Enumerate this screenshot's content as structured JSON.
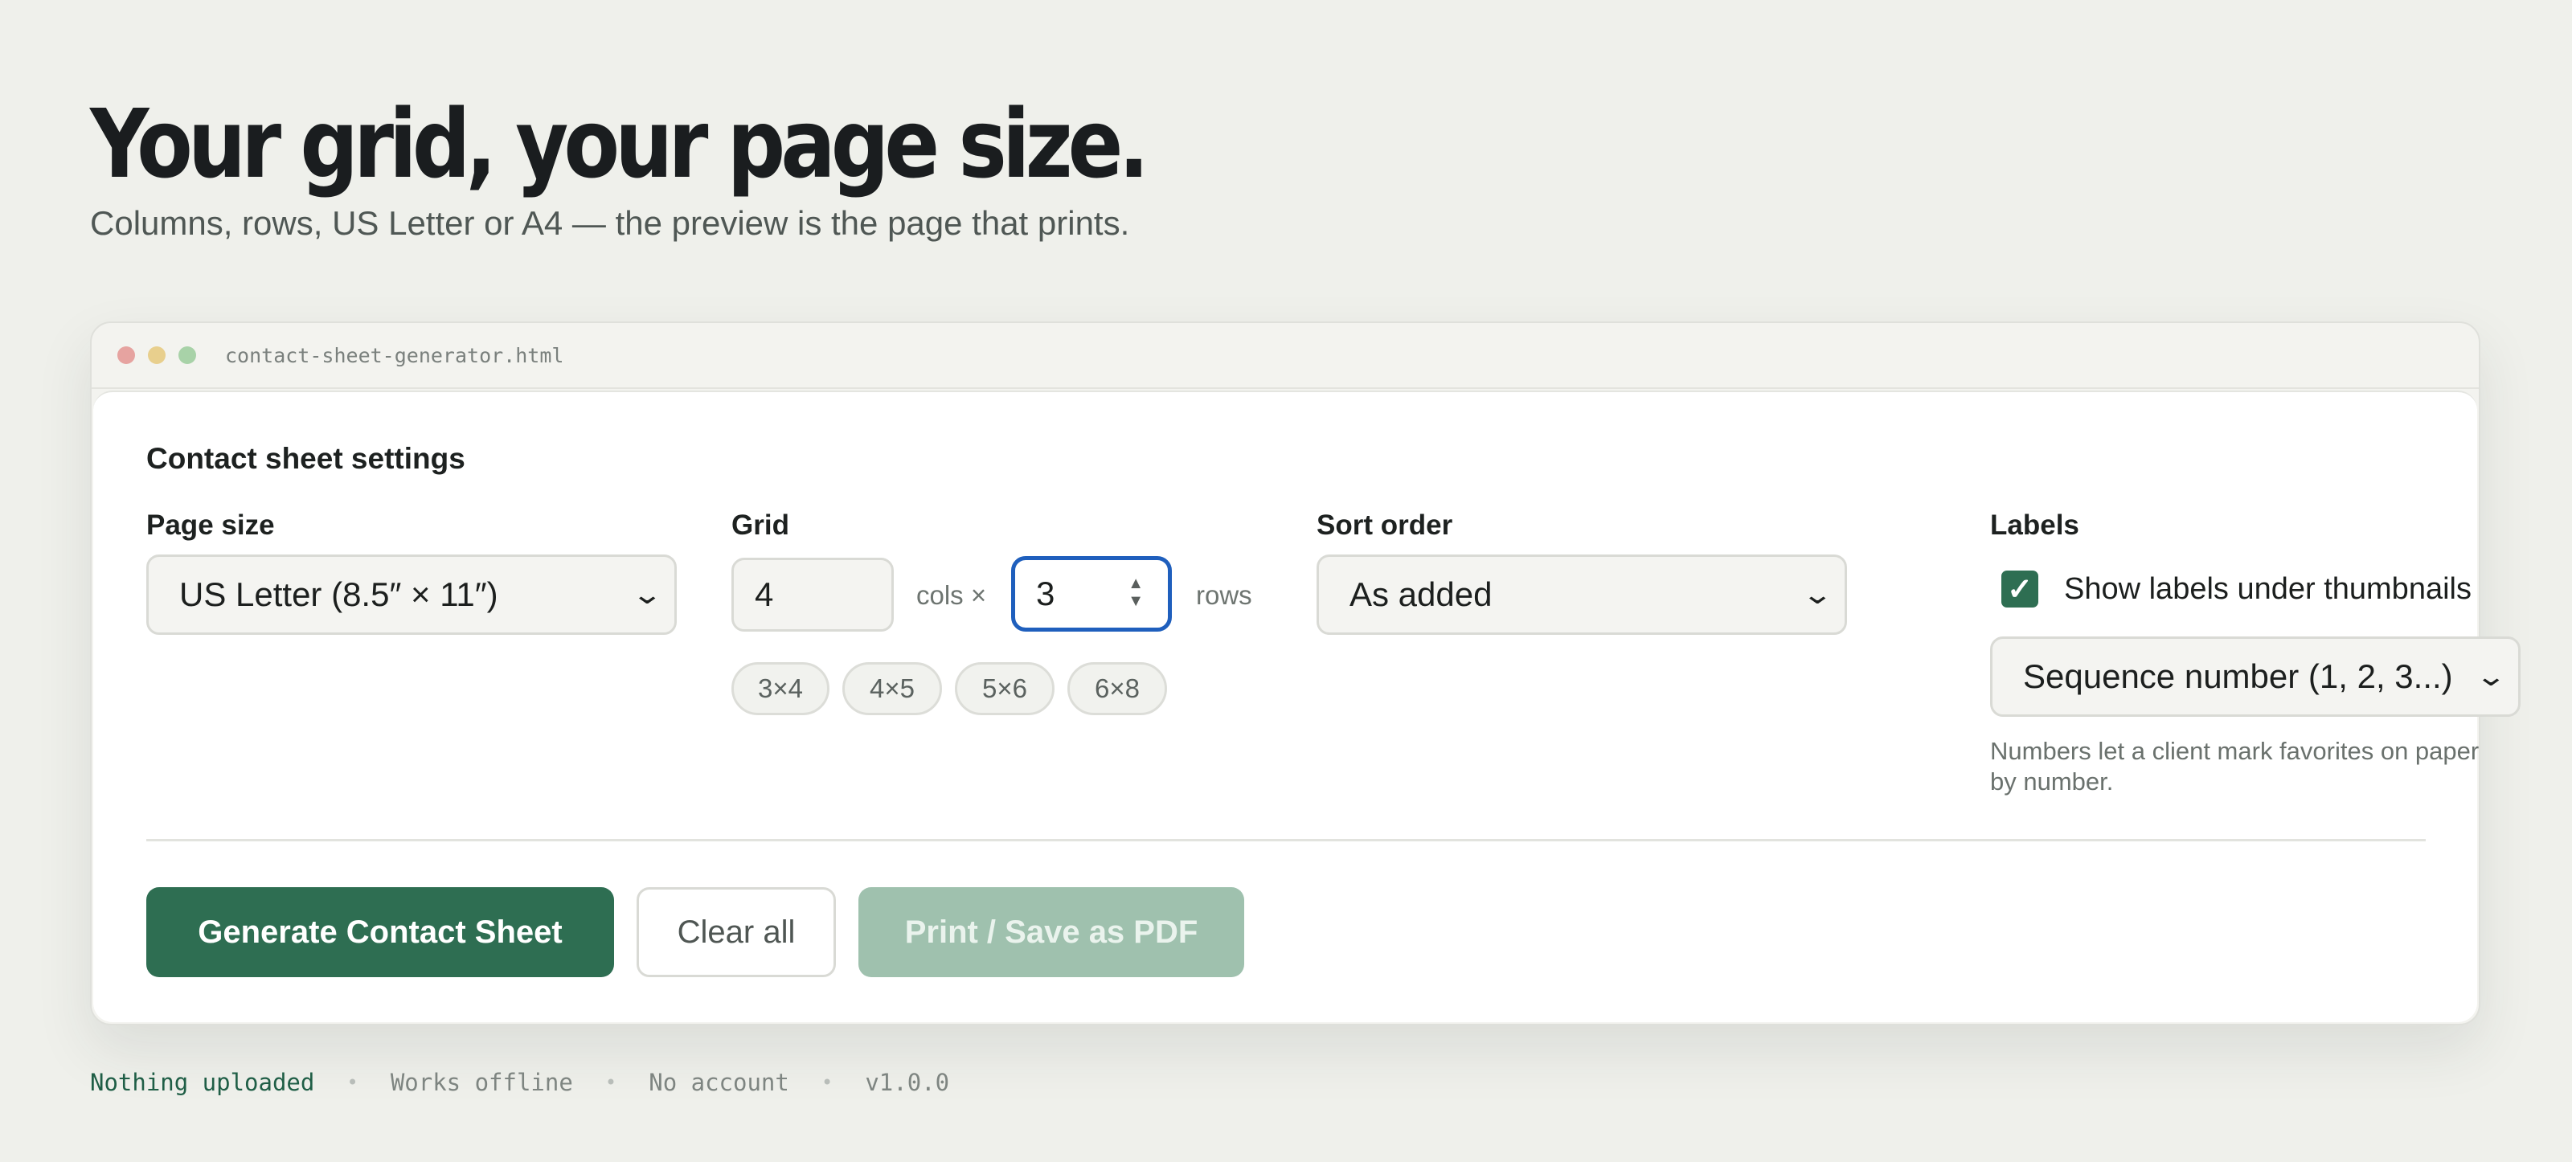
{
  "hero": {
    "title": "Your grid, your page size.",
    "subtitle": "Columns, rows, US Letter or A4 — the preview is the page that prints."
  },
  "window": {
    "title": "contact-sheet-generator.html"
  },
  "settings": {
    "heading": "Contact sheet settings",
    "page_size": {
      "label": "Page size",
      "selected": "US Letter (8.5″ × 11″)"
    },
    "grid": {
      "label": "Grid",
      "cols_value": "4",
      "cols_unit": "cols ×",
      "rows_value": "3",
      "rows_unit": "rows",
      "presets": [
        "3×4",
        "4×5",
        "5×6",
        "6×8"
      ]
    },
    "sort": {
      "label": "Sort order",
      "selected": "As added"
    },
    "labels": {
      "label": "Labels",
      "checkbox_label": "Show labels under thumbnails",
      "checked": true,
      "style_selected": "Sequence number (1, 2, 3...)",
      "hint": "Numbers let a client mark favorites on paper by number."
    }
  },
  "actions": {
    "generate": "Generate Contact Sheet",
    "clear": "Clear all",
    "print": "Print / Save as PDF"
  },
  "footer": {
    "items": [
      "Nothing uploaded",
      "Works offline",
      "No account",
      "v1.0.0"
    ],
    "separator": "•"
  },
  "colors": {
    "accent": "#2e6e52",
    "focus": "#1f5fbd",
    "disabled": "#9fc1ae"
  },
  "icons": {
    "checkbox": "check-icon",
    "select": "chevron-down-icon",
    "spinner": "spinner-icon"
  }
}
